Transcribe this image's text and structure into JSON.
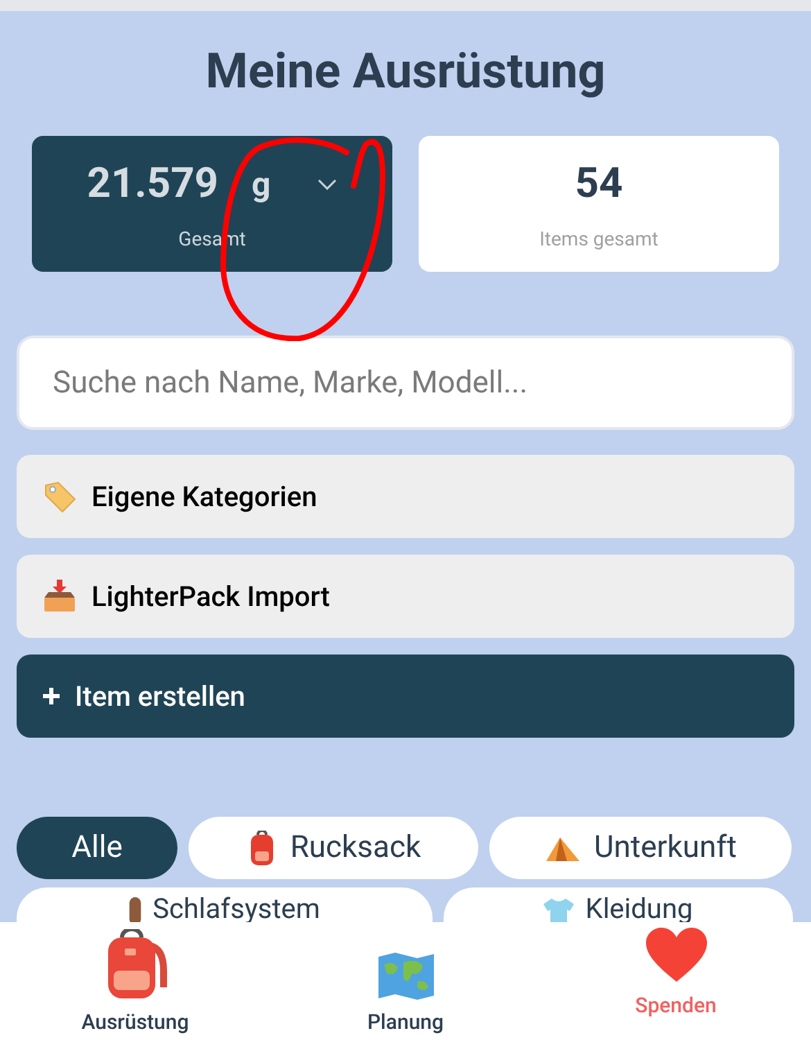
{
  "title": "Meine Ausrüstung",
  "stats": {
    "weight": {
      "value": "21.579",
      "unit": "g",
      "label": "Gesamt"
    },
    "items": {
      "value": "54",
      "label": "Items gesamt"
    }
  },
  "search": {
    "placeholder": "Suche nach Name, Marke, Modell..."
  },
  "actions": [
    {
      "label": "Eigene Kategorien",
      "kind": "secondary"
    },
    {
      "label": "LighterPack Import",
      "kind": "secondary"
    },
    {
      "label": "Item erstellen",
      "kind": "primary"
    }
  ],
  "chips": [
    {
      "label": "Alle",
      "selected": true
    },
    {
      "label": "Rucksack",
      "selected": false
    },
    {
      "label": "Unterkunft",
      "selected": false
    },
    {
      "label": "Schlafsystem",
      "selected": false
    },
    {
      "label": "Kleidung",
      "selected": false
    }
  ],
  "nav": [
    {
      "label": "Ausrüstung",
      "kind": "page"
    },
    {
      "label": "Planung",
      "kind": "page"
    },
    {
      "label": "Spenden",
      "kind": "donate"
    }
  ]
}
